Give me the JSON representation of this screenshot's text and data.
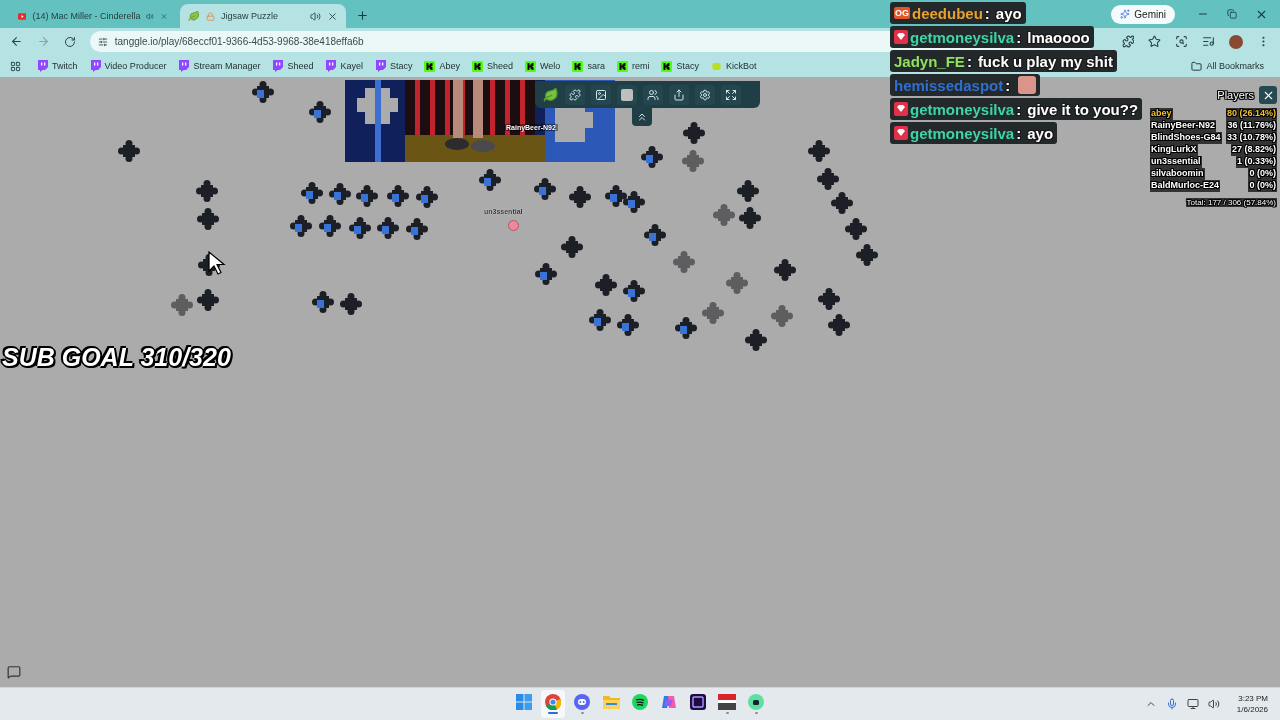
{
  "browser": {
    "tabs": [
      {
        "title": "(14) Mac Miller - Cinderella",
        "kind": "youtube",
        "selected": false
      },
      {
        "title": "Jigsaw Puzzle",
        "kind": "puzzle",
        "selected": true
      }
    ],
    "gemini": "Gemini",
    "url": "tanggle.io/play/68eccf01-9366-4d53-9968-38e418effa6b",
    "bookmarks": [
      {
        "label": "Twitch",
        "kind": "twitch"
      },
      {
        "label": "Video Producer",
        "kind": "twitch"
      },
      {
        "label": "Stream Manager",
        "kind": "twitch"
      },
      {
        "label": "Sheed",
        "kind": "twitch"
      },
      {
        "label": "Kayel",
        "kind": "twitch"
      },
      {
        "label": "Stacy",
        "kind": "twitch"
      },
      {
        "label": "Abey",
        "kind": "kick"
      },
      {
        "label": "Sheed",
        "kind": "kick"
      },
      {
        "label": "Welo",
        "kind": "kick"
      },
      {
        "label": "sara",
        "kind": "kick"
      },
      {
        "label": "remi",
        "kind": "kick"
      },
      {
        "label": "Stacy",
        "kind": "kick"
      },
      {
        "label": "KickBot",
        "kind": "bot"
      }
    ],
    "all_bookmarks": "All Bookmarks"
  },
  "puzzle": {
    "sub_goal": "SUB GOAL 310/320",
    "peer_label": "RainyBeer-N92",
    "cursor_label": "un3ssential",
    "players": {
      "title": "Players",
      "rows": [
        {
          "name": "abey",
          "score": "80 (26.14%)",
          "selected": true
        },
        {
          "name": "RainyBeer-N92",
          "score": "36 (11.76%)",
          "selected": false
        },
        {
          "name": "BlindShoes-G84",
          "score": "33 (10.78%)",
          "selected": false
        },
        {
          "name": "KingLurkX",
          "score": "27 (8.82%)",
          "selected": false
        },
        {
          "name": "un3ssential",
          "score": "1 (0.33%)",
          "selected": false
        },
        {
          "name": "silvaboomin",
          "score": "0 (0%)",
          "selected": false
        },
        {
          "name": "BaldMurloc-E24",
          "score": "0 (0%)",
          "selected": false
        }
      ],
      "total": "Total: 177 / 306 (57.84%)"
    }
  },
  "chat": [
    {
      "user": "deedubeu",
      "color": "#e8a030",
      "badge": {
        "kind": "text",
        "text": "OG"
      },
      "separator": ":",
      "message": "ayo"
    },
    {
      "user": "getmoneysilva",
      "color": "#3fd3a8",
      "badge": {
        "kind": "gem"
      },
      "separator": ":",
      "message": "lmaoooo"
    },
    {
      "user": "Jadyn_FE",
      "color": "#8fe35a",
      "separator": ":",
      "message": "fuck u play my shit"
    },
    {
      "user": "hemissedaspot",
      "color": "#2f6fd0",
      "separator": ":",
      "emote": true
    },
    {
      "user": "getmoneysilva",
      "color": "#3fd3a8",
      "badge": {
        "kind": "gem"
      },
      "separator": ":",
      "message": "give it to you??"
    },
    {
      "user": "getmoneysilva",
      "color": "#3fd3a8",
      "badge": {
        "kind": "gem"
      },
      "separator": ":",
      "message": "ayo"
    }
  ],
  "taskbar": {
    "apps": [
      {
        "kind": "start",
        "active": false,
        "running": false
      },
      {
        "kind": "chrome",
        "active": true,
        "running": true
      },
      {
        "kind": "discord",
        "active": false,
        "running": true
      },
      {
        "kind": "files",
        "active": false,
        "running": false
      },
      {
        "kind": "spotify",
        "active": false,
        "running": false
      },
      {
        "kind": "copilot",
        "active": false,
        "running": false
      },
      {
        "kind": "premiere",
        "active": false,
        "running": false
      },
      {
        "kind": "recorder",
        "active": false,
        "running": true
      },
      {
        "kind": "bot",
        "active": false,
        "running": true
      }
    ],
    "time": "3:23 PM",
    "date": "1/6/2026"
  }
}
